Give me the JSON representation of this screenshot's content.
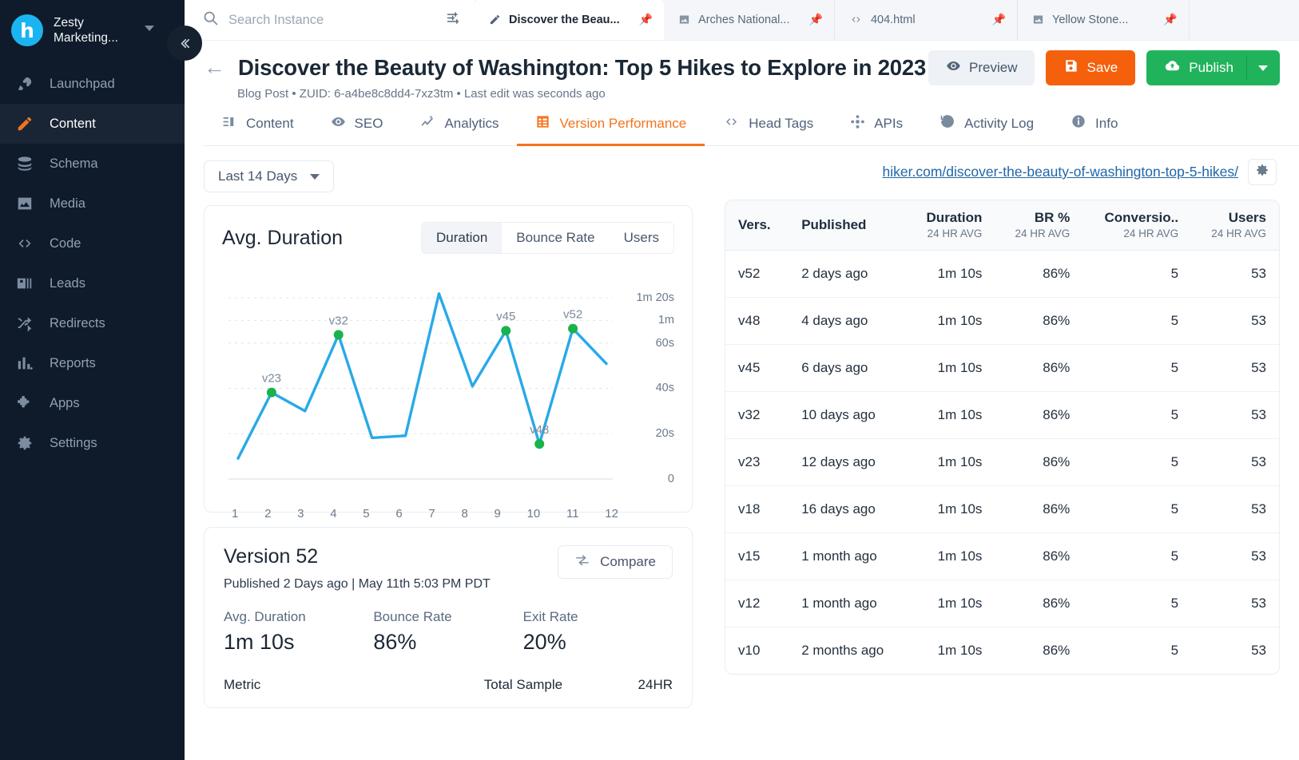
{
  "sidebar": {
    "brand": {
      "initial": "h",
      "name": "Zesty Marketing..."
    },
    "items": [
      {
        "label": "Launchpad",
        "icon": "rocket-icon",
        "active": false
      },
      {
        "label": "Content",
        "icon": "pencil-icon",
        "active": true
      },
      {
        "label": "Schema",
        "icon": "database-icon",
        "active": false
      },
      {
        "label": "Media",
        "icon": "image-icon",
        "active": false
      },
      {
        "label": "Code",
        "icon": "code-icon",
        "active": false
      },
      {
        "label": "Leads",
        "icon": "contact-card-icon",
        "active": false
      },
      {
        "label": "Redirects",
        "icon": "shuffle-icon",
        "active": false
      },
      {
        "label": "Reports",
        "icon": "bar-chart-icon",
        "active": false
      },
      {
        "label": "Apps",
        "icon": "puzzle-icon",
        "active": false
      },
      {
        "label": "Settings",
        "icon": "gear-icon",
        "active": false
      }
    ]
  },
  "topbar": {
    "search_placeholder": "Search Instance",
    "search_value": "",
    "browser_tabs": [
      {
        "label": "Discover the Beau...",
        "icon": "pencil-icon",
        "active": true
      },
      {
        "label": "Arches National...",
        "icon": "image-icon",
        "active": false
      },
      {
        "label": "404.html",
        "icon": "code-icon",
        "active": false
      },
      {
        "label": "Yellow Stone...",
        "icon": "image-icon",
        "active": false
      }
    ]
  },
  "header": {
    "title": "Discover the Beauty of Washington: Top 5 Hikes to Explore in 2023",
    "meta": "Blog Post  •  ZUID: 6-a4be8c8dd4-7xz3tm  •  Last edit was seconds ago",
    "preview_label": "Preview",
    "save_label": "Save",
    "publish_label": "Publish"
  },
  "tabs": [
    {
      "label": "Content",
      "icon": "list-icon",
      "active": false
    },
    {
      "label": "SEO",
      "icon": "eye-icon",
      "active": false
    },
    {
      "label": "Analytics",
      "icon": "trend-icon",
      "active": false
    },
    {
      "label": "Version Performance",
      "icon": "grid-icon",
      "active": true
    },
    {
      "label": "Head Tags",
      "icon": "code-icon",
      "active": false
    },
    {
      "label": "APIs",
      "icon": "api-icon",
      "active": false
    },
    {
      "label": "Activity Log",
      "icon": "history-icon",
      "active": false
    },
    {
      "label": "Info",
      "icon": "info-icon",
      "active": false
    }
  ],
  "filters": {
    "date_range": "Last 14 Days"
  },
  "url_bar": {
    "url": "hiker.com/discover-the-beauty-of-washington-top-5-hikes/"
  },
  "chart_panel": {
    "title": "Avg. Duration",
    "segments": [
      {
        "label": "Duration",
        "active": true
      },
      {
        "label": "Bounce Rate",
        "active": false
      },
      {
        "label": "Users",
        "active": false
      }
    ]
  },
  "chart_data": {
    "type": "line",
    "title": "Avg. Duration",
    "xlabel": "",
    "ylabel": "",
    "x": [
      1,
      2,
      3,
      4,
      5,
      6,
      7,
      8,
      9,
      10,
      11,
      12
    ],
    "categories": [
      "1",
      "2",
      "3",
      "4",
      "5",
      "6",
      "7",
      "8",
      "9",
      "10",
      "11",
      "12"
    ],
    "values": [
      10,
      42,
      33,
      70,
      20,
      21,
      90,
      45,
      72,
      17,
      73,
      56
    ],
    "ytick_labels": [
      "1m 20s",
      "1m",
      "60s",
      "40s",
      "20s",
      "0"
    ],
    "ytick_values": [
      80,
      70,
      60,
      40,
      20,
      0
    ],
    "ylim": [
      0,
      80
    ],
    "grid": true,
    "legend": "none",
    "line_color": "#28a9e8",
    "marker_color": "#19b34b",
    "annotations": [
      {
        "x": 2,
        "label": "v23",
        "value": 42
      },
      {
        "x": 4,
        "label": "v32",
        "value": 70
      },
      {
        "x": 9,
        "label": "v45",
        "value": 72
      },
      {
        "x": 10,
        "label": "v48",
        "value": 17
      },
      {
        "x": 11,
        "label": "v52",
        "value": 73
      }
    ]
  },
  "version_panel": {
    "title": "Version 52",
    "published": "Published 2 Days ago | May 11th 5:03 PM PDT",
    "compare_label": "Compare",
    "stats": [
      {
        "key": "Avg. Duration",
        "value": "1m 10s"
      },
      {
        "key": "Bounce Rate",
        "value": "86%"
      },
      {
        "key": "Exit Rate",
        "value": "20%"
      }
    ],
    "metric_header": {
      "metric": "Metric",
      "total_sample": "Total Sample",
      "hr": "24HR"
    }
  },
  "table": {
    "columns": [
      {
        "label": "Vers.",
        "sub": "",
        "align": "left"
      },
      {
        "label": "Published",
        "sub": "",
        "align": "left"
      },
      {
        "label": "Duration",
        "sub": "24 HR AVG",
        "align": "right"
      },
      {
        "label": "BR %",
        "sub": "24 HR AVG",
        "align": "right"
      },
      {
        "label": "Conversio..",
        "sub": "24 HR AVG",
        "align": "right"
      },
      {
        "label": "Users",
        "sub": "24 HR AVG",
        "align": "right"
      }
    ],
    "rows": [
      [
        "v52",
        "2 days ago",
        "1m 10s",
        "86%",
        "5",
        "53"
      ],
      [
        "v48",
        "4 days ago",
        "1m 10s",
        "86%",
        "5",
        "53"
      ],
      [
        "v45",
        "6 days ago",
        "1m 10s",
        "86%",
        "5",
        "53"
      ],
      [
        "v32",
        "10 days ago",
        "1m 10s",
        "86%",
        "5",
        "53"
      ],
      [
        "v23",
        "12 days ago",
        "1m 10s",
        "86%",
        "5",
        "53"
      ],
      [
        "v18",
        "16 days ago",
        "1m 10s",
        "86%",
        "5",
        "53"
      ],
      [
        "v15",
        "1 month ago",
        "1m 10s",
        "86%",
        "5",
        "53"
      ],
      [
        "v12",
        "1 month ago",
        "1m 10s",
        "86%",
        "5",
        "53"
      ],
      [
        "v10",
        "2 months ago",
        "1m 10s",
        "86%",
        "5",
        "53"
      ]
    ]
  },
  "colors": {
    "accent": "#f4731c",
    "save": "#f4600c",
    "publish": "#21b35c",
    "sidebar_bg": "#0f1a2a",
    "link": "#2166a8",
    "chart_line": "#28a9e8",
    "chart_marker": "#19b34b"
  }
}
